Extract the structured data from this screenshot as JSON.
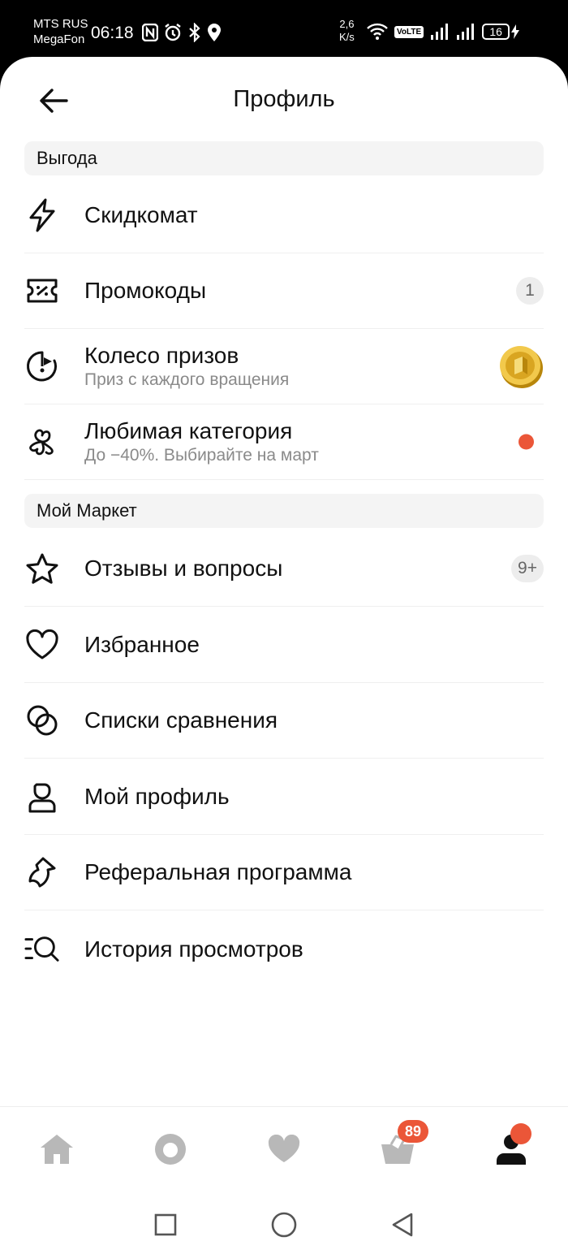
{
  "status_bar": {
    "carrier_1": "MTS RUS",
    "carrier_2": "MegaFon",
    "time": "06:18",
    "net_speed_value": "2,6",
    "net_speed_unit": "K/s",
    "volte": "VoLTE",
    "battery": "16"
  },
  "header": {
    "title": "Профиль",
    "back_icon": "arrow-left-icon"
  },
  "sections": [
    {
      "title": "Выгода",
      "items": [
        {
          "label": "Скидкомат",
          "icon": "lightning-icon"
        },
        {
          "label": "Промокоды",
          "icon": "coupon-icon",
          "badge": "1"
        },
        {
          "label": "Колесо призов",
          "sub": "Приз с каждого вращения",
          "icon": "prize-wheel-icon",
          "right_icon": "coin-icon"
        },
        {
          "label": "Любимая категория",
          "sub": "До −40%. Выбирайте на март",
          "icon": "clover-icon",
          "indicator": "red-dot"
        }
      ]
    },
    {
      "title": "Мой Маркет",
      "items": [
        {
          "label": "Отзывы и вопросы",
          "icon": "star-icon",
          "badge": "9+"
        },
        {
          "label": "Избранное",
          "icon": "heart-icon"
        },
        {
          "label": "Списки сравнения",
          "icon": "compare-icon"
        },
        {
          "label": "Мой профиль",
          "icon": "user-icon"
        },
        {
          "label": "Реферальная программа",
          "icon": "referral-icon"
        },
        {
          "label": "История просмотров",
          "icon": "history-search-icon"
        }
      ]
    }
  ],
  "bottom_nav": {
    "tabs": [
      {
        "name": "home",
        "icon": "home-icon"
      },
      {
        "name": "assistant",
        "icon": "alice-icon"
      },
      {
        "name": "favorites",
        "icon": "heart-icon"
      },
      {
        "name": "cart",
        "icon": "basket-icon",
        "badge": "89"
      },
      {
        "name": "profile",
        "icon": "profile-icon",
        "active": true,
        "indicator": "red-dot"
      }
    ]
  },
  "system_nav": {
    "buttons": [
      "recent-apps-icon",
      "home-circle-icon",
      "back-triangle-icon"
    ]
  },
  "colors": {
    "accent_red": "#eb5638",
    "text": "#111111",
    "muted": "#8a8a8a",
    "section_bg": "#f4f4f4",
    "inactive_icon": "#b8b8b8"
  }
}
